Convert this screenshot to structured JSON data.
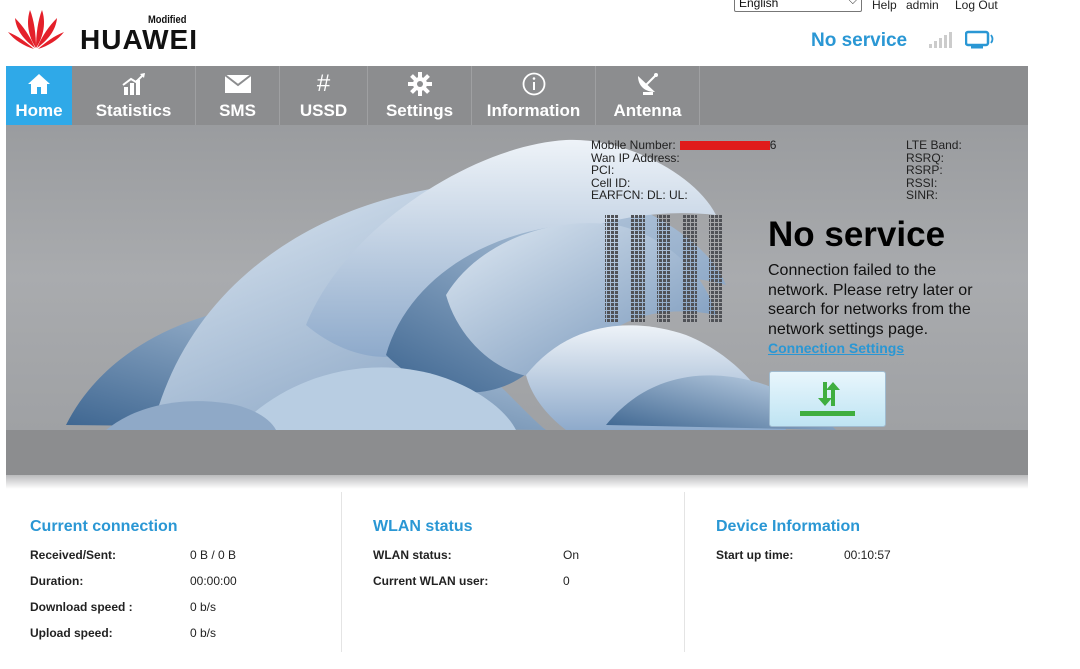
{
  "header": {
    "brand": "HUAWEI",
    "brand_tag": "Modified",
    "language": "English",
    "links": [
      "Help",
      "admin",
      "Log Out"
    ],
    "status_text": "No service"
  },
  "nav": {
    "items": [
      {
        "label": "Home",
        "icon": "home-icon",
        "active": true
      },
      {
        "label": "Statistics",
        "icon": "chart-icon",
        "active": false
      },
      {
        "label": "SMS",
        "icon": "envelope-icon",
        "active": false
      },
      {
        "label": "USSD",
        "icon": "hash-icon",
        "active": false
      },
      {
        "label": "Settings",
        "icon": "gear-icon",
        "active": false
      },
      {
        "label": "Information",
        "icon": "info-icon",
        "active": false
      },
      {
        "label": "Antenna",
        "icon": "satellite-dish-icon",
        "active": false
      }
    ]
  },
  "hero": {
    "left_info": {
      "mobile_number_label": "Mobile Number:",
      "mobile_number_tail": "6",
      "wan_ip_label": "Wan IP Address:",
      "pci_label": "PCI:",
      "cell_id_label": "Cell ID:",
      "earfcn_label": "EARFCN: DL: UL:"
    },
    "right_info": {
      "lte_band_label": "LTE Band:",
      "rsrq_label": "RSRQ:",
      "rsrp_label": "RSRP:",
      "rssi_label": "RSSI:",
      "sinr_label": "SINR:"
    },
    "status_title": "No service",
    "status_message": "Connection failed to the network. Please retry later or search for networks from the network settings page.",
    "connection_settings_link": "Connection Settings"
  },
  "panels": {
    "current_connection": {
      "title": "Current connection",
      "rows": [
        {
          "key": "Received/Sent:",
          "value": "0 B /  0 B"
        },
        {
          "key": "Duration:",
          "value": "00:00:00"
        },
        {
          "key": "Download speed :",
          "value": "0 b/s"
        },
        {
          "key": "Upload speed:",
          "value": "0 b/s"
        }
      ]
    },
    "wlan_status": {
      "title": "WLAN status",
      "rows": [
        {
          "key": "WLAN status:",
          "value": "On"
        },
        {
          "key": "Current WLAN user:",
          "value": "0"
        }
      ]
    },
    "device_information": {
      "title": "Device Information",
      "rows": [
        {
          "key": "Start up time:",
          "value": "00:10:57"
        }
      ]
    }
  },
  "colors": {
    "accent": "#2a97d4",
    "nav_bg": "#8c8d8f",
    "nav_active": "#2fa9e8",
    "huawei_red": "#e4202a"
  }
}
